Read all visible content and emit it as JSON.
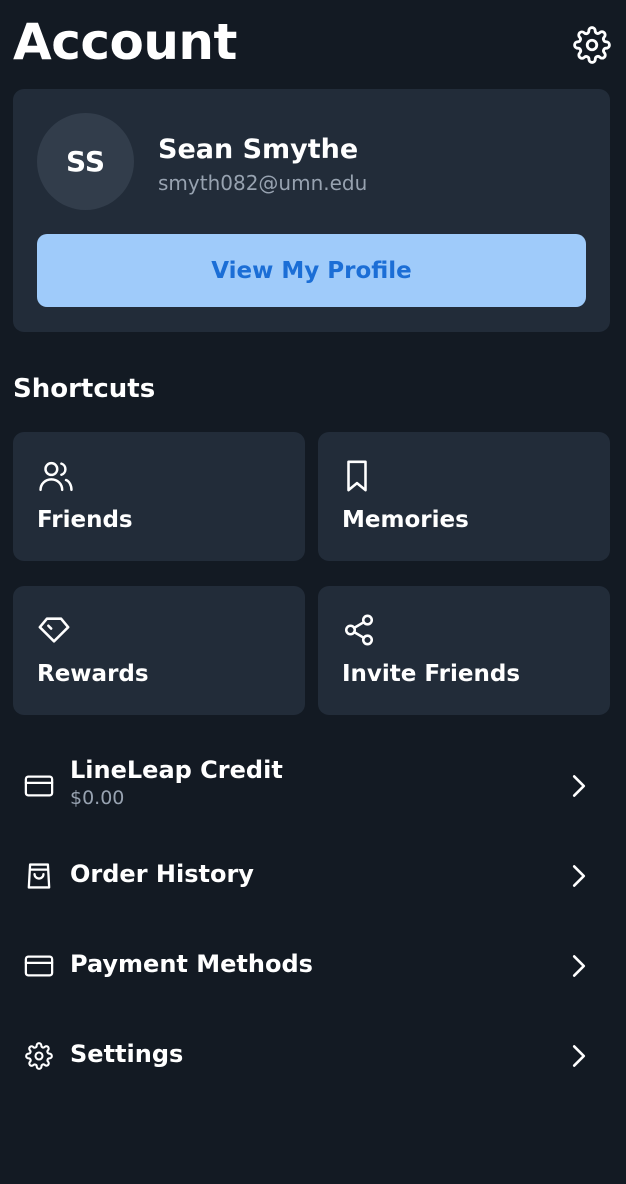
{
  "header": {
    "title": "Account",
    "settings_icon": "gear-icon"
  },
  "profile": {
    "initials": "SS",
    "name": "Sean Smythe",
    "email": "smyth082@umn.edu",
    "view_profile_label": "View My Profile"
  },
  "shortcuts": {
    "title": "Shortcuts",
    "items": [
      {
        "label": "Friends",
        "icon": "users-icon"
      },
      {
        "label": "Memories",
        "icon": "bookmark-icon"
      },
      {
        "label": "Rewards",
        "icon": "tag-icon"
      },
      {
        "label": "Invite Friends",
        "icon": "share-icon"
      }
    ]
  },
  "menu": {
    "items": [
      {
        "label": "LineLeap Credit",
        "sublabel": "$0.00",
        "icon": "credit-card-icon"
      },
      {
        "label": "Order History",
        "icon": "shopping-bag-icon"
      },
      {
        "label": "Payment Methods",
        "icon": "credit-card-icon"
      },
      {
        "label": "Settings",
        "icon": "gear-icon"
      }
    ]
  },
  "colors": {
    "background": "#131a23",
    "card": "#222c39",
    "button_bg": "#9fcbfa",
    "button_text": "#1b6ed6",
    "muted_text": "#97a2b0"
  }
}
